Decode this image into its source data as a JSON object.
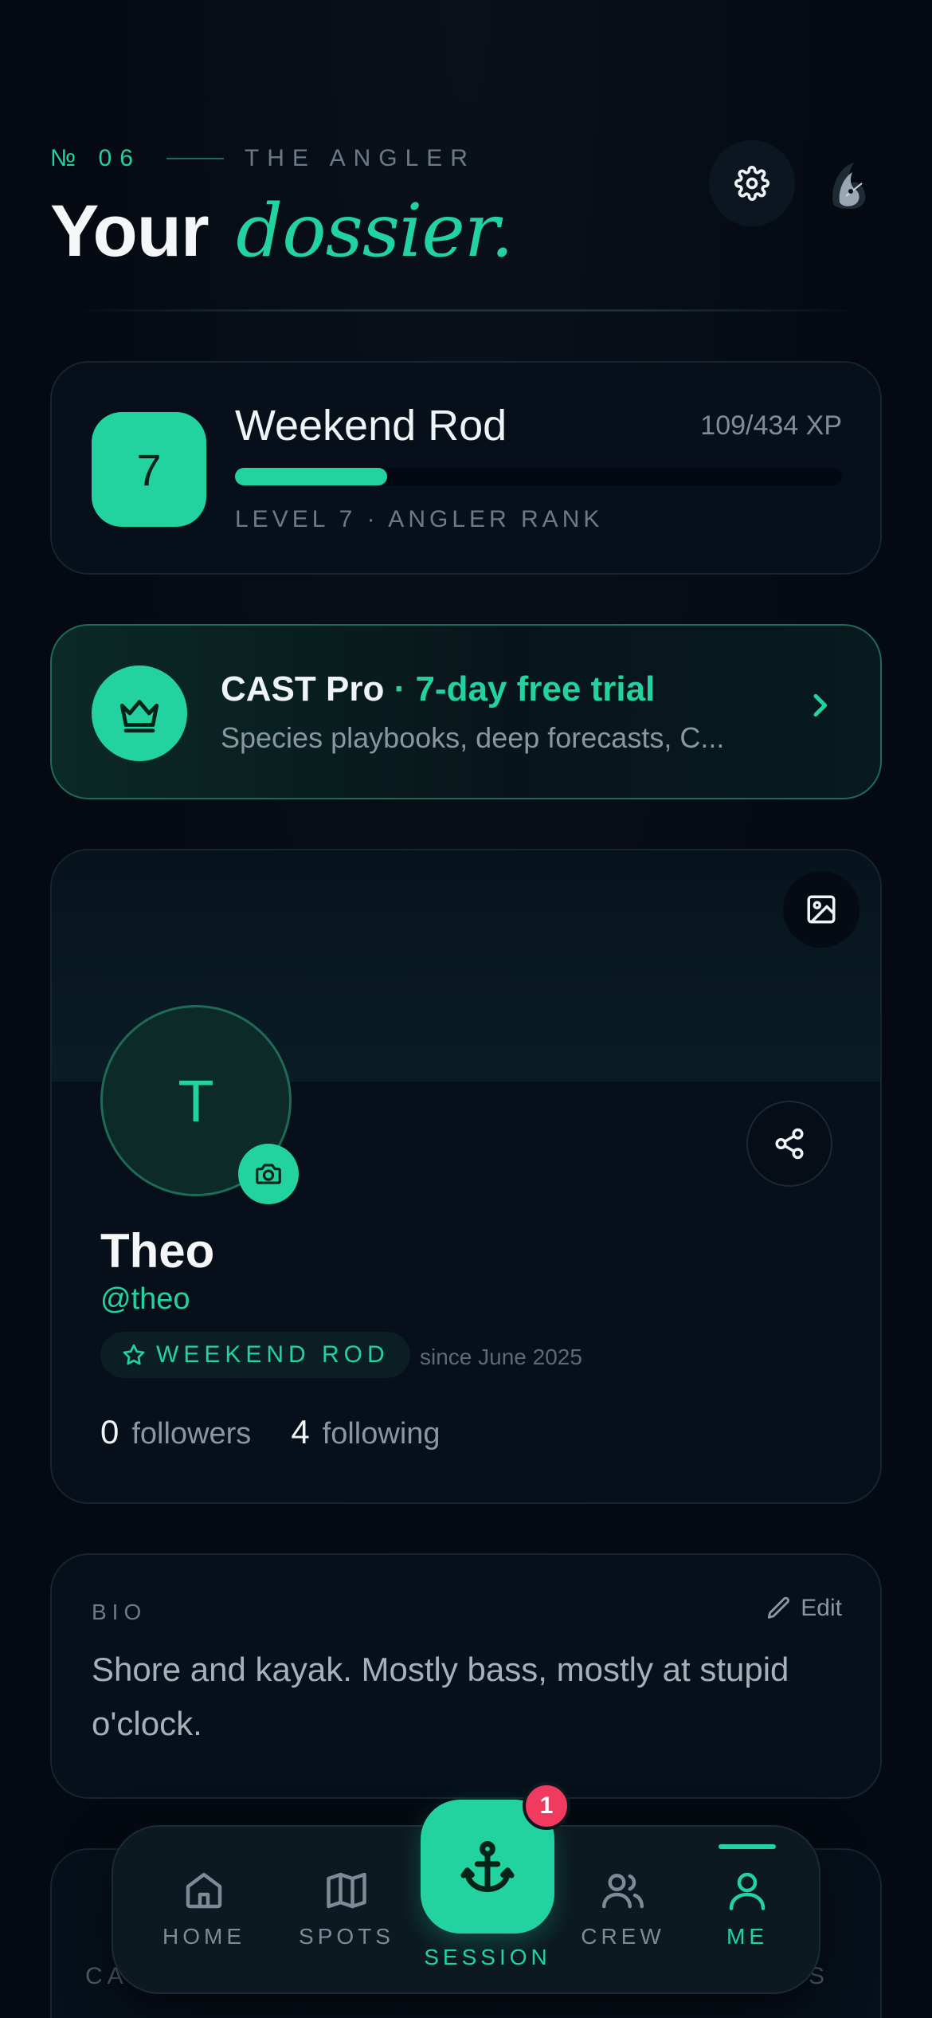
{
  "header": {
    "issue_number": "№ 06",
    "section_label": "THE ANGLER",
    "title_plain": "Your",
    "title_accent": "dossier.",
    "settings_icon": "gear-icon",
    "avatar_icon": "angler-avatar-icon"
  },
  "level": {
    "number": "7",
    "name": "Weekend Rod",
    "xp_text": "109/434 XP",
    "xp_fraction": 0.251,
    "rank_line": "LEVEL 7 · ANGLER RANK"
  },
  "pro": {
    "icon": "crown-icon",
    "name": "CAST Pro",
    "trial": " · 7-day free trial",
    "subtitle": "Species playbooks, deep forecasts, C...",
    "chevron_icon": "chevron-right-icon"
  },
  "profile": {
    "cover_icon": "image-icon",
    "avatar_initial": "T",
    "camera_icon": "camera-icon",
    "share_icon": "share-icon",
    "name": "Theo",
    "handle": "@theo",
    "rank_badge": "WEEKEND ROD",
    "since": "since June 2025",
    "followers_count": "0",
    "followers_label": "followers",
    "following_count": "4",
    "following_label": "following"
  },
  "bio": {
    "label": "BIO",
    "edit_label": "Edit",
    "text": "Shore and kayak. Mostly bass, mostly at stupid o'clock."
  },
  "next_section": {
    "left_label": "CA",
    "right_label": "S"
  },
  "nav": {
    "items": [
      {
        "label": "HOME",
        "icon": "home-icon"
      },
      {
        "label": "SPOTS",
        "icon": "map-icon"
      },
      {
        "label": "SESSION",
        "icon": "anchor-icon",
        "badge": "1"
      },
      {
        "label": "CREW",
        "icon": "users-icon"
      },
      {
        "label": "ME",
        "icon": "user-icon"
      }
    ],
    "active": "ME"
  },
  "colors": {
    "accent": "#22d3a0",
    "background": "#050a12",
    "badge": "#f03a5f"
  }
}
